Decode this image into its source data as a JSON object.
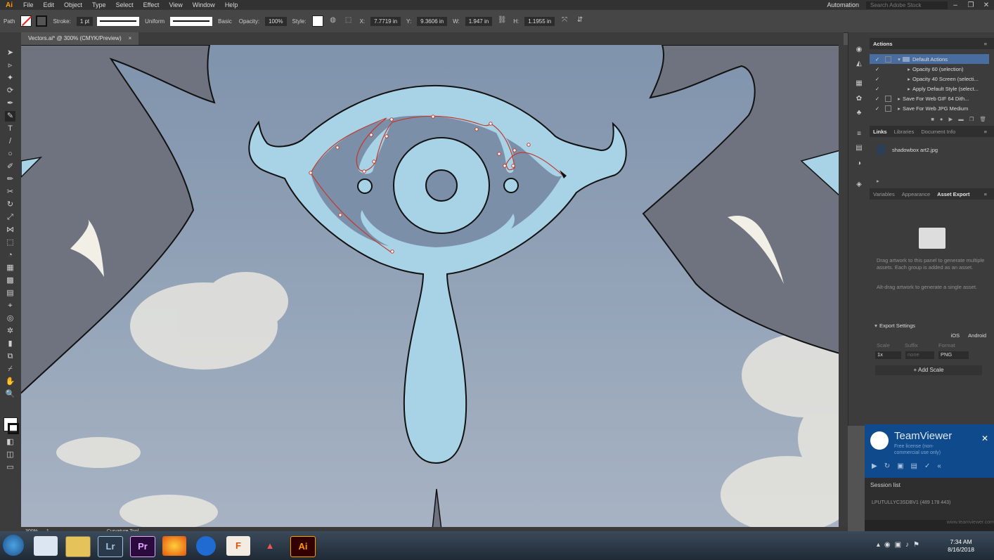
{
  "menu": {
    "logo": "Ai",
    "items": [
      "File",
      "Edit",
      "Object",
      "Type",
      "Select",
      "Effect",
      "View",
      "Window",
      "Help"
    ],
    "workspace": "Automation",
    "search_placeholder": "Search Adobe Stock"
  },
  "control": {
    "selection": "Path",
    "stroke_label": "Stroke:",
    "stroke_weight": "1 pt",
    "profile": "Uniform",
    "brush": "Basic",
    "opacity_label": "Opacity:",
    "opacity": "100%",
    "style_label": "Style:",
    "x_label": "X:",
    "x": "7.7719 in",
    "y_label": "Y:",
    "y": "9.3606 in",
    "w_label": "W:",
    "w": "1.947 in",
    "h_label": "H:",
    "h": "1.1955 in"
  },
  "document": {
    "tab_title": "Vectors.ai* @ 300% (CMYK/Preview)",
    "zoom": "300%",
    "artboard": "1",
    "tool_status": "Curvature Tool"
  },
  "panels": {
    "actions_tab": "Actions",
    "actions": [
      "Default Actions",
      "Opacity 60 (selection)",
      "Opacity 40 Screen (selecti...",
      "Apply Default Style (select...",
      "Save For Web GIF 64 Dith...",
      "Save For Web JPG Medium"
    ],
    "links_tabs": [
      "Links",
      "Libraries",
      "Document Info"
    ],
    "link_file": "shadowbox art2.jpg",
    "export_tabs": [
      "Variables",
      "Appearance",
      "Asset Export"
    ],
    "export_help1": "Drag artwork to this panel to generate multiple assets. Each group is added as an asset.",
    "export_help2": "Alt-drag artwork to generate a single asset.",
    "export_settings": "Export Settings",
    "ios": "iOS",
    "android": "Android",
    "scale_label": "Scale",
    "suffix_label": "Suffix",
    "format_label": "Format",
    "scale": "1x",
    "suffix_placeholder": "none",
    "format": "PNG",
    "add_scale": "+ Add Scale"
  },
  "teamviewer": {
    "title": "TeamViewer",
    "subtitle": "Free license (non-commercial use only)",
    "session_list": "Session list",
    "session": "LPUTULLYC3SDBV1 (489 178 443)",
    "url": "www.teamviewer.com"
  },
  "taskbar": {
    "apps": [
      "Lr",
      "Pr",
      "Ai"
    ],
    "time": "7:34 AM",
    "date": "8/16/2018"
  }
}
